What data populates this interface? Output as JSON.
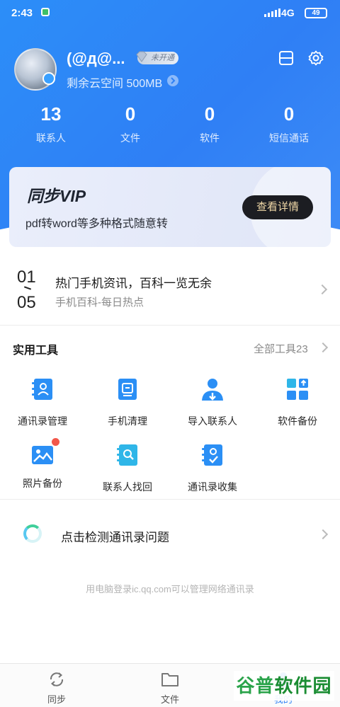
{
  "status_bar": {
    "time": "2:43",
    "network": "4G",
    "battery": "49"
  },
  "profile": {
    "username": "(@д@...",
    "vip_tag": "未开通",
    "cloud_space": "剩余云空间 500MB"
  },
  "stats": [
    {
      "value": "13",
      "label": "联系人"
    },
    {
      "value": "0",
      "label": "文件"
    },
    {
      "value": "0",
      "label": "软件"
    },
    {
      "value": "0",
      "label": "短信通话"
    }
  ],
  "vip_card": {
    "title": "同步VIP",
    "description": "pdf转word等多种格式随意转",
    "button": "查看详情"
  },
  "news": {
    "date_top": "01",
    "date_bottom": "05",
    "title": "热门手机资讯，百科一览无余",
    "subtitle": "手机百科-每日热点"
  },
  "tools": {
    "title": "实用工具",
    "all_link": "全部工具23",
    "items": [
      {
        "label": "通讯录管理",
        "icon": "contacts-book-icon"
      },
      {
        "label": "手机清理",
        "icon": "phone-clean-icon"
      },
      {
        "label": "导入联系人",
        "icon": "import-contact-icon"
      },
      {
        "label": "软件备份",
        "icon": "app-backup-icon"
      },
      {
        "label": "照片备份",
        "icon": "photo-backup-icon"
      },
      {
        "label": "联系人找回",
        "icon": "contact-recover-icon"
      },
      {
        "label": "通讯录收集",
        "icon": "contacts-collect-icon"
      }
    ]
  },
  "detect": {
    "label": "点击检测通讯录问题"
  },
  "footer_note": "用电脑登录ic.qq.com可以管理网络通讯录",
  "tabs": [
    {
      "label": "同步",
      "icon": "sync-icon"
    },
    {
      "label": "文件",
      "icon": "folder-icon"
    },
    {
      "label": "我的",
      "icon": "profile-icon"
    }
  ],
  "watermark": {
    "part_a": "谷普",
    "part_b": "软件园"
  },
  "colors": {
    "primary": "#2f82f6",
    "tool_blue": "#2b8ff5",
    "tool_cyan": "#2fb6e8",
    "badge_red": "#f2574a",
    "vip_button_text": "#f1d9a8"
  }
}
